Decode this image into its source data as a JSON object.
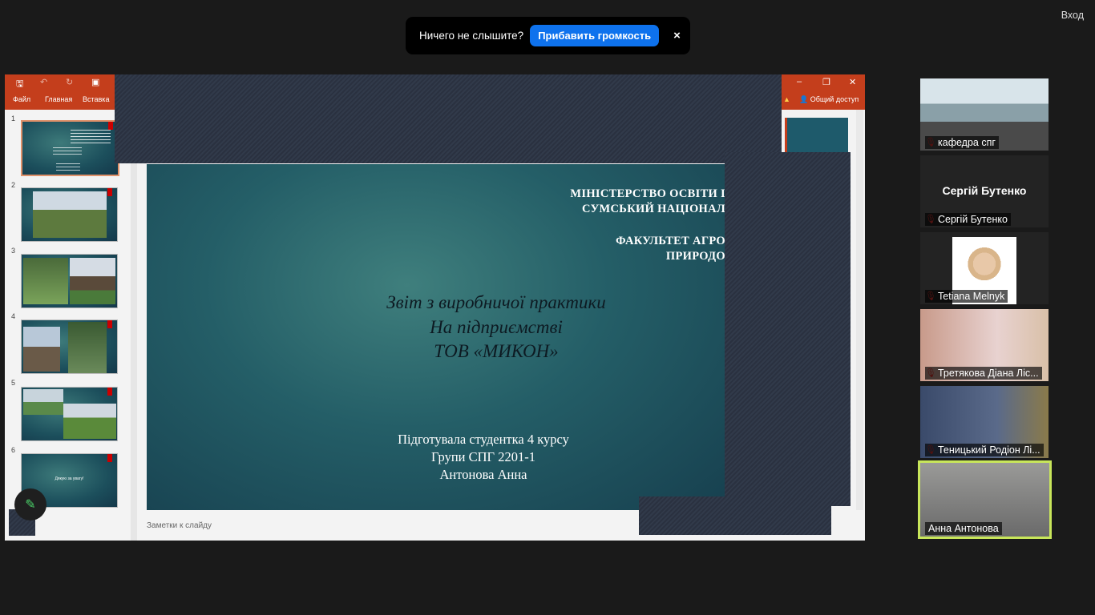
{
  "banner": {
    "text": "Ничего не слышите?",
    "button": "Прибавить громкость",
    "close": "×"
  },
  "login": "Вход",
  "ppt": {
    "tabs": [
      "Файл",
      "Главная",
      "Вставка"
    ],
    "share": "Общий доступ",
    "notes": "Заметки к слайду",
    "thumb_numbers": [
      "1",
      "2",
      "3",
      "4",
      "5",
      "6"
    ],
    "thumb6_text": "Дякую за увагу!"
  },
  "slide": {
    "head1": "МІНІСТЕРСТВО  ОСВІТИ І",
    "head2": "СУМСЬКИЙ НАЦІОНАЛ",
    "head3": "ФАКУЛЬТЕТ  АГРО",
    "head4": "ПРИРОДО",
    "title1": "Звіт з виробничої практики",
    "title2": "На підприємстві",
    "title3": "ТОВ «МИКОН»",
    "foot1": "Підготувала студентка 4 курсу",
    "foot2": "Групи СПГ 2201-1",
    "foot3": "Антонова Анна"
  },
  "participants": [
    {
      "name": "кафедра спг",
      "muted": true
    },
    {
      "name": "Сергій Бутенко",
      "display": "Сергій Бутенко",
      "muted": true
    },
    {
      "name": "Tetiana Melnyk",
      "muted": true
    },
    {
      "name": "Третякова Діана  Ліс...",
      "muted": true
    },
    {
      "name": "Теницький Родіон Лі...",
      "muted": true
    },
    {
      "name": "Анна Антонова",
      "muted": false,
      "active": true
    }
  ]
}
